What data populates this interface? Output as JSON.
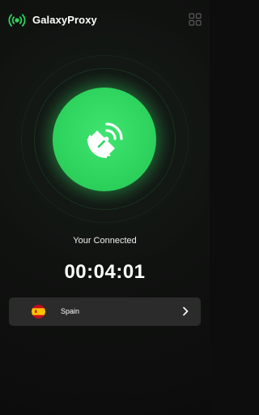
{
  "header": {
    "title": "GalaxyProxy",
    "logo_icon": "broadcast-icon",
    "menu_icon": "grid-icon"
  },
  "connect": {
    "icon": "satellite-dish-icon",
    "status": "Your Connected",
    "timer": "00:04:01"
  },
  "server": {
    "country": "Spain",
    "flag_icon": "spain-flag-icon",
    "chevron_icon": "chevron-right-icon"
  },
  "colors": {
    "background": "#0d0d0d",
    "accent": "#2fd55f",
    "card": "#2b2b2b",
    "text": "#ffffff"
  }
}
